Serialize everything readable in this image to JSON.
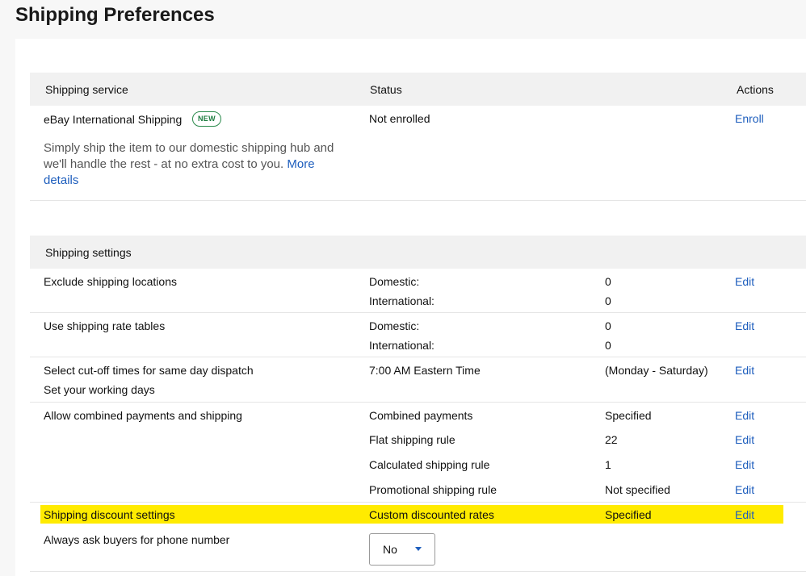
{
  "page": {
    "title": "Shipping Preferences"
  },
  "services_table": {
    "headers": {
      "service": "Shipping service",
      "status": "Status",
      "actions": "Actions"
    },
    "row": {
      "name": "eBay International Shipping",
      "badge": "NEW",
      "description": "Simply ship the item to our domestic shipping hub and we'll handle the rest - at no extra cost to you.",
      "more_link": "More details",
      "status": "Not enrolled",
      "action": "Enroll"
    }
  },
  "settings_table": {
    "header": "Shipping settings",
    "rows": [
      {
        "label": "Exclude shipping locations",
        "items": [
          {
            "name": "Domestic:",
            "value": "0",
            "action": "Edit"
          },
          {
            "name": "International:",
            "value": "0"
          }
        ]
      },
      {
        "label": "Use shipping rate tables",
        "items": [
          {
            "name": "Domestic:",
            "value": "0",
            "action": "Edit"
          },
          {
            "name": "International:",
            "value": "0"
          }
        ]
      },
      {
        "label": "Select cut-off times for same day dispatch",
        "sublabel": "Set your working days",
        "items": [
          {
            "name": "7:00 AM Eastern Time",
            "value": "(Monday - Saturday)",
            "action": "Edit"
          }
        ]
      },
      {
        "label": "Allow combined payments and shipping",
        "items": [
          {
            "name": "Combined payments",
            "value": "Specified",
            "action": "Edit"
          },
          {
            "name": "Flat shipping rule",
            "value": "22",
            "action": "Edit"
          },
          {
            "name": "Calculated shipping rule",
            "value": "1",
            "action": "Edit"
          },
          {
            "name": "Promotional shipping rule",
            "value": "Not specified",
            "action": "Edit"
          }
        ]
      },
      {
        "label": "Shipping discount settings",
        "highlighted": true,
        "items": [
          {
            "name": "Custom discounted rates",
            "value": "Specified",
            "action": "Edit"
          }
        ]
      },
      {
        "label": "Always ask buyers for phone number",
        "select_value": "No"
      }
    ]
  },
  "colors": {
    "link": "#1e5ebd",
    "highlight": "#ffeb00",
    "badge": "#2a8a4b"
  }
}
